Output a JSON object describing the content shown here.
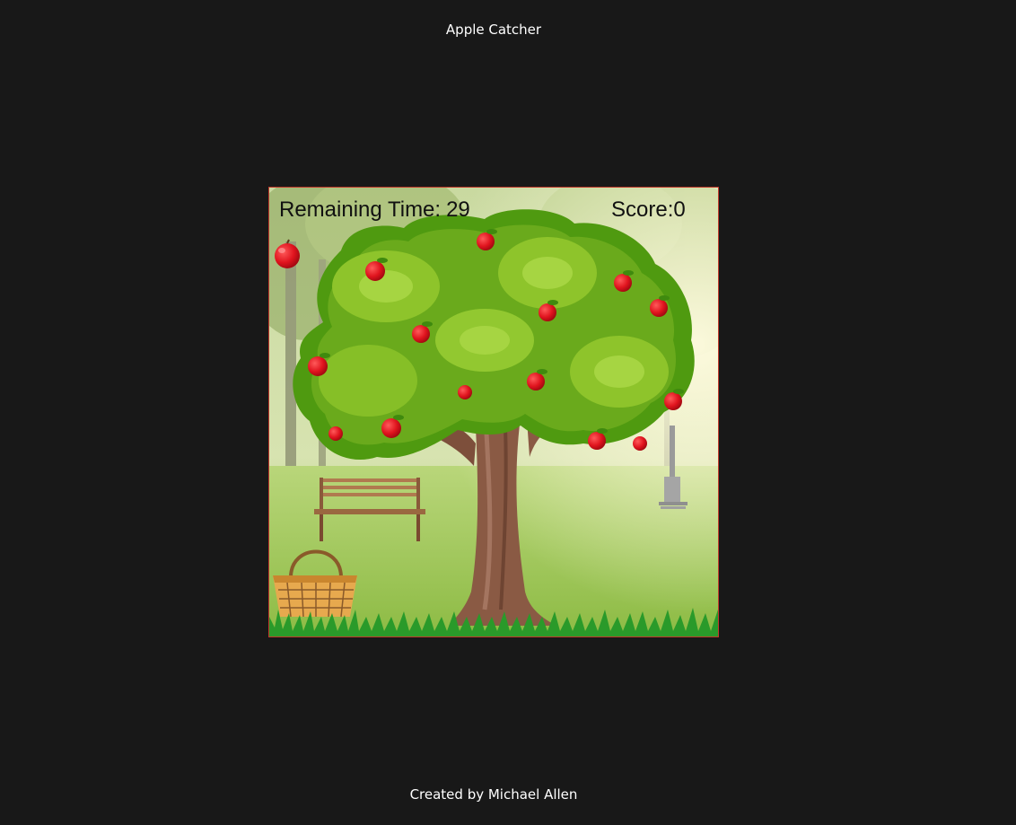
{
  "page": {
    "title": "Apple Catcher",
    "footer": "Created by Michael Allen"
  },
  "hud": {
    "time_label": "Remaining Time:",
    "time_value": "29",
    "score_label": "Score:",
    "score_value": "0"
  },
  "colors": {
    "page_background": "#181818",
    "frame_border": "#c0392b",
    "apple": "#e0141e",
    "foliage": "#6aaa1c",
    "trunk": "#8a5a44",
    "grass": "#2a9a2a"
  },
  "scene": {
    "icons": [
      "falling-apple-icon",
      "apple-tree-icon",
      "bench-icon",
      "lamp-post-icon",
      "basket-icon",
      "grass-icon"
    ]
  }
}
